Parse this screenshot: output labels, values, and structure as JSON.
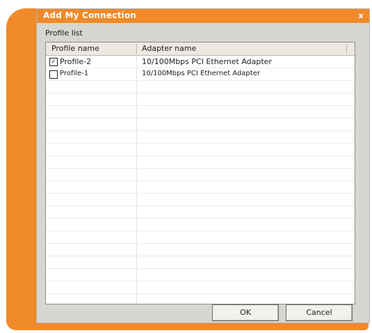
{
  "window": {
    "title": "Add My Connection",
    "close_glyph": "x"
  },
  "profile_list": {
    "label": "Profile list",
    "columns": [
      "Profile name",
      "Adapter name"
    ],
    "rows": [
      {
        "checked": true,
        "name": "Profile-2",
        "adapter": "10/100Mbps PCI Ethernet Adapter"
      },
      {
        "checked": false,
        "name": "Profile-1",
        "adapter": "10/100Mbps PCI Ethernet Adapter"
      }
    ]
  },
  "buttons": {
    "ok": "OK",
    "cancel": "Cancel"
  },
  "colors": {
    "accent": "#f08a2a",
    "dialog_bg": "#d8d6d0"
  },
  "icons": {
    "close": "close-icon",
    "checkbox_checked": "checkbox-checked-icon",
    "checkbox_unchecked": "checkbox-unchecked-icon"
  }
}
